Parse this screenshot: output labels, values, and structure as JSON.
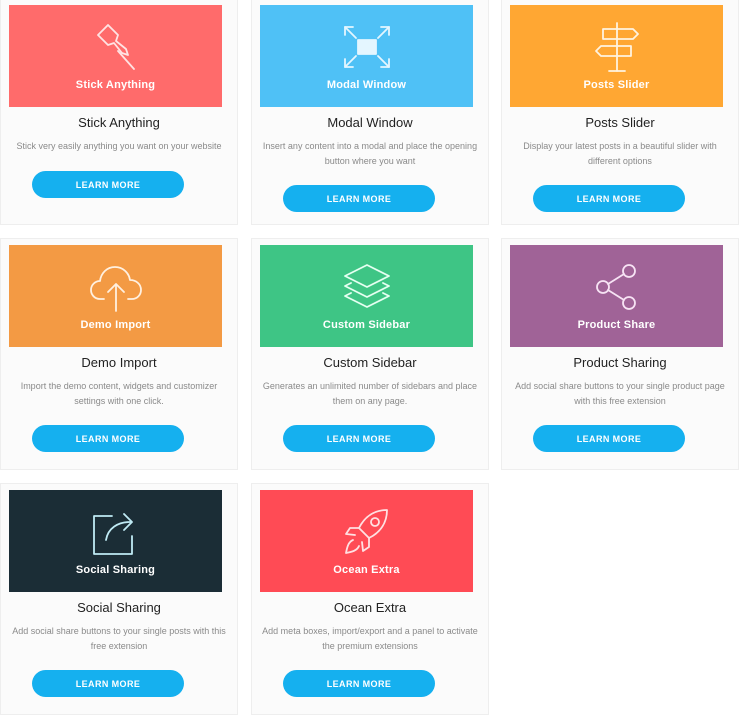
{
  "button_label": "LEARN MORE",
  "cards": [
    {
      "banner_label": "Stick Anything",
      "title": "Stick Anything",
      "description": "Stick very easily anything you want on your website",
      "color": "#ff6b6b",
      "icon": "pushpin-icon"
    },
    {
      "banner_label": "Modal Window",
      "title": "Modal Window",
      "description": "Insert any content into a modal and place the opening button where you want",
      "color": "#4fc1f6",
      "icon": "expand-arrows-icon"
    },
    {
      "banner_label": "Posts Slider",
      "title": "Posts Slider",
      "description": "Display your latest posts in a beautiful slider with different options",
      "color": "#ffa733",
      "icon": "signpost-icon"
    },
    {
      "banner_label": "Demo Import",
      "title": "Demo Import",
      "description": "Import the demo content, widgets and customizer settings with one click.",
      "color": "#f39a44",
      "icon": "cloud-upload-icon"
    },
    {
      "banner_label": "Custom Sidebar",
      "title": "Custom Sidebar",
      "description": "Generates an unlimited number of sidebars and place them on any page.",
      "color": "#3ec585",
      "icon": "layers-icon"
    },
    {
      "banner_label": "Product Share",
      "title": "Product Sharing",
      "description": "Add social share buttons to your single product page with this free extension",
      "color": "#a06397",
      "icon": "share-icon"
    },
    {
      "banner_label": "Social Sharing",
      "title": "Social Sharing",
      "description": "Add social share buttons to your single posts with this free extension",
      "color": "#1b2d36",
      "icon": "share-arrow-box-icon"
    },
    {
      "banner_label": "Ocean Extra",
      "title": "Ocean Extra",
      "description": "Add meta boxes, import/export and a panel to activate the premium extensions",
      "color": "#ff4b55",
      "icon": "rocket-icon"
    }
  ]
}
